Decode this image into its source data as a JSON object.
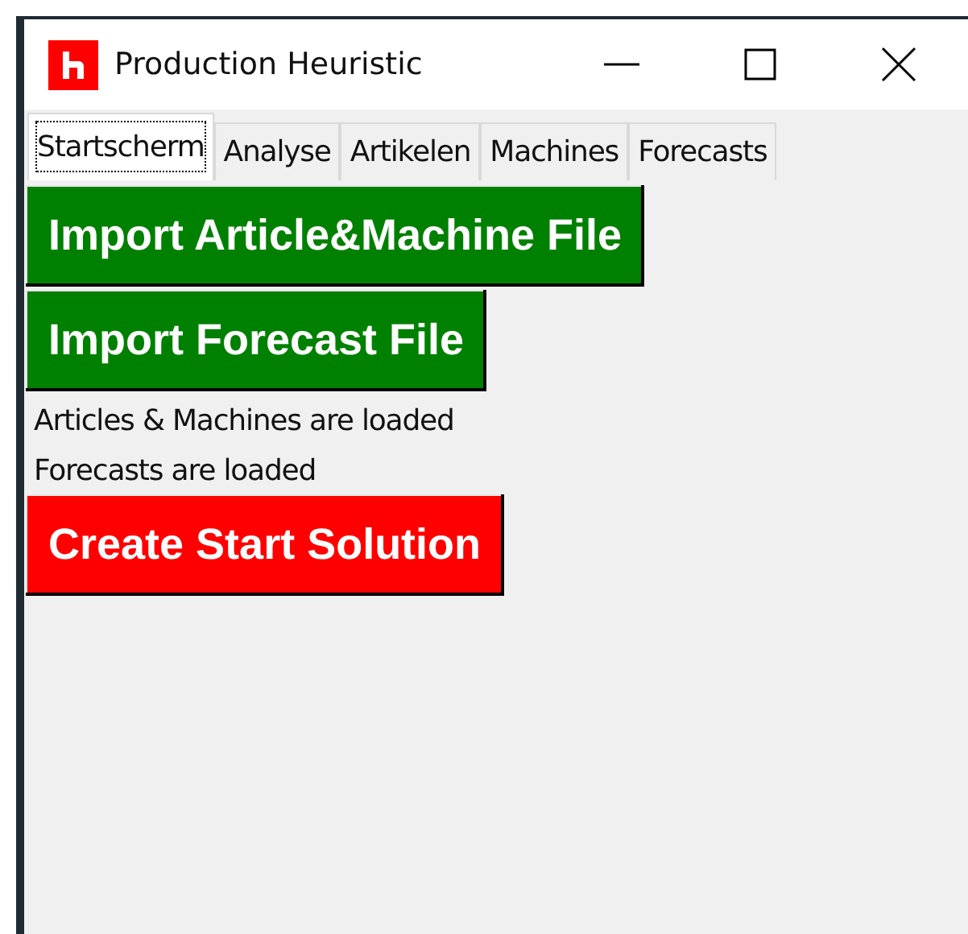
{
  "window": {
    "title": "Production Heuristic"
  },
  "tabs": [
    {
      "label": "Startscherm",
      "selected": true
    },
    {
      "label": "Analyse",
      "selected": false
    },
    {
      "label": "Artikelen",
      "selected": false
    },
    {
      "label": "Machines",
      "selected": false
    },
    {
      "label": "Forecasts",
      "selected": false
    }
  ],
  "content": [
    {
      "kind": "button",
      "label": "Import Article&Machine File",
      "color": "#008000"
    },
    {
      "kind": "button",
      "label": "Import Forecast File",
      "color": "#008000"
    },
    {
      "kind": "status",
      "label": "Articles & Machines are loaded"
    },
    {
      "kind": "status",
      "label": "Forecasts are loaded"
    },
    {
      "kind": "button",
      "label": "Create Start Solution",
      "color": "#ff0000"
    }
  ]
}
